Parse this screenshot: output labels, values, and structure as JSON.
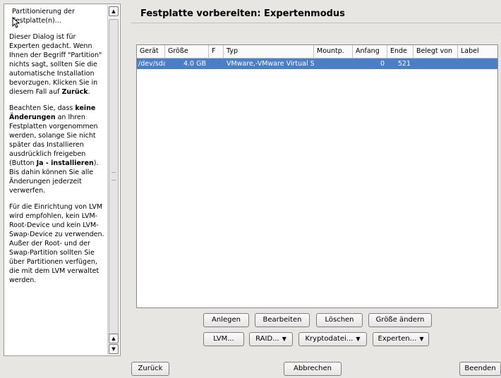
{
  "help": {
    "heading": "Partitionierung der Festplatte(n)...",
    "p1": "Dieser Dialog ist für Experten gedacht. Wenn Ihnen der Begriff \"Partition\" nichts sagt, sollten Sie die automatische Installation bevorzugen. Klicken Sie in diesem Fall auf",
    "p1_bold": "Zurück",
    "p1_end": ".",
    "p2_a": "Beachten Sie, dass",
    "p2_bold1": "keine Änderungen",
    "p2_b": "an Ihren Festplatten vorgenommen werden, solange Sie nicht später das Installieren ausdrücklich freigeben (Button",
    "p2_bold2": "Ja - installieren",
    "p2_c": "). Bis dahin können Sie alle Änderungen jederzeit verwerfen.",
    "p3": "Für die Einrichtung von LVM wird empfohlen, kein LVM-Root-Device und kein LVM-Swap-Device zu verwenden. Außer der Root- und der Swap-Partition sollten Sie über Partitionen verfügen, die mit dem LVM verwaltet werden."
  },
  "title": "Festplatte vorbereiten: Expertenmodus",
  "table": {
    "columns": [
      "Gerät",
      "Größe",
      "F",
      "Typ",
      "Mountp.",
      "Anfang",
      "Ende",
      "Belegt von",
      "Label"
    ],
    "rows": [
      {
        "device": "/dev/sda",
        "size": "4.0 GB",
        "f": "",
        "type": "VMware,-VMware Virtual S",
        "mount": "",
        "start": "0",
        "end": "521",
        "used_by": "",
        "label": ""
      }
    ]
  },
  "buttons": {
    "create": "Anlegen",
    "edit": "Bearbeiten",
    "delete": "Löschen",
    "resize": "Größe ändern",
    "lvm": "LVM...",
    "raid": "RAID...",
    "crypt": "Kryptodatei...",
    "expert": "Experten..."
  },
  "footer": {
    "back": "Zurück",
    "abort": "Abbrechen",
    "finish": "Beenden"
  },
  "icons": [
    "scroll-up-arrow-icon",
    "scroll-down-arrow-icon",
    "mouse-cursor-icon",
    "dropdown-caret-icon"
  ],
  "colors": {
    "selection": "#4a7fc6",
    "background": "#e8e6e3"
  }
}
